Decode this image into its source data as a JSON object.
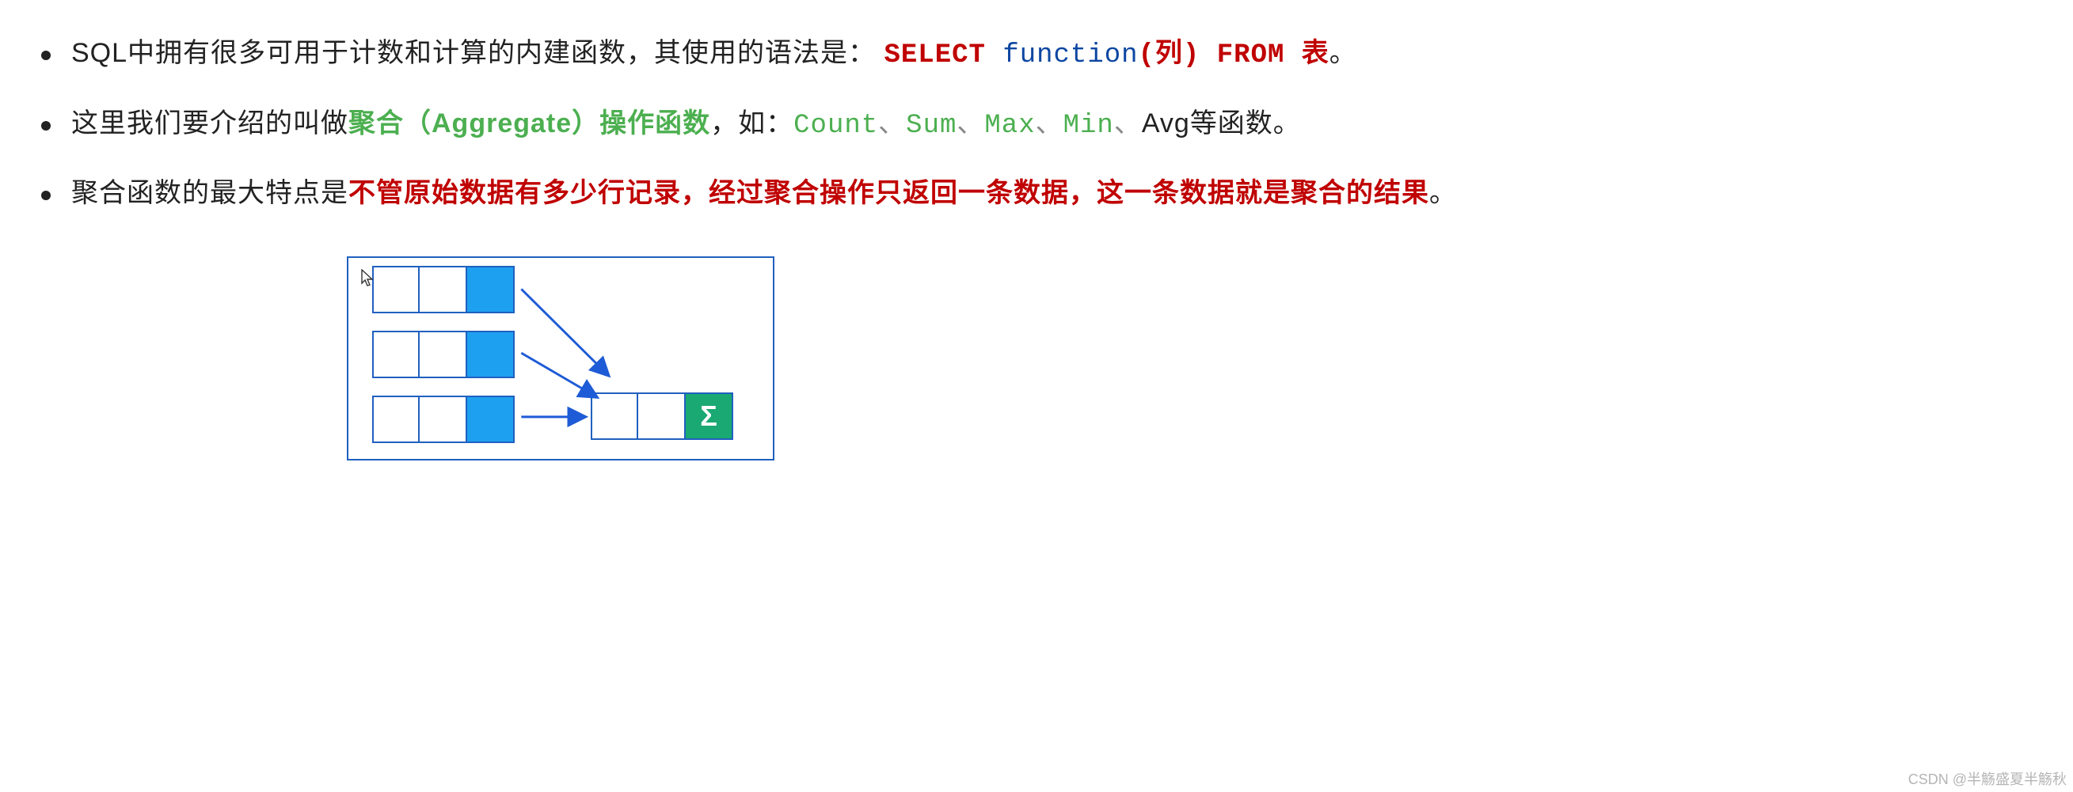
{
  "bullets": {
    "b1": {
      "p1": "SQL中拥有很多可用于计数和计算的内建函数，其使用的语法是：",
      "select": "SELECT ",
      "func": "function",
      "col": "(列)",
      "from_kw": " FROM ",
      "tbl": "表",
      "p1_end": "。"
    },
    "b2": {
      "p1": "这里我们要介绍的叫做",
      "agg": "聚合（Aggregate）操作函数",
      "p2": "，如：",
      "f_count": "Count",
      "f_sum": "Sum",
      "f_max": "Max",
      "f_min": "Min",
      "f_avg": "Avg",
      "sep": "、",
      "p3": "等函数。"
    },
    "b3": {
      "p1": "聚合函数的最大特点是",
      "hl": "不管原始数据有多少行记录，经过聚合操作只返回一条数据，这一条数据就是聚合的结果",
      "p1_end": "。"
    }
  },
  "diagram": {
    "sigma": "Σ"
  },
  "watermark": "CSDN @半觞盛夏半觞秋"
}
